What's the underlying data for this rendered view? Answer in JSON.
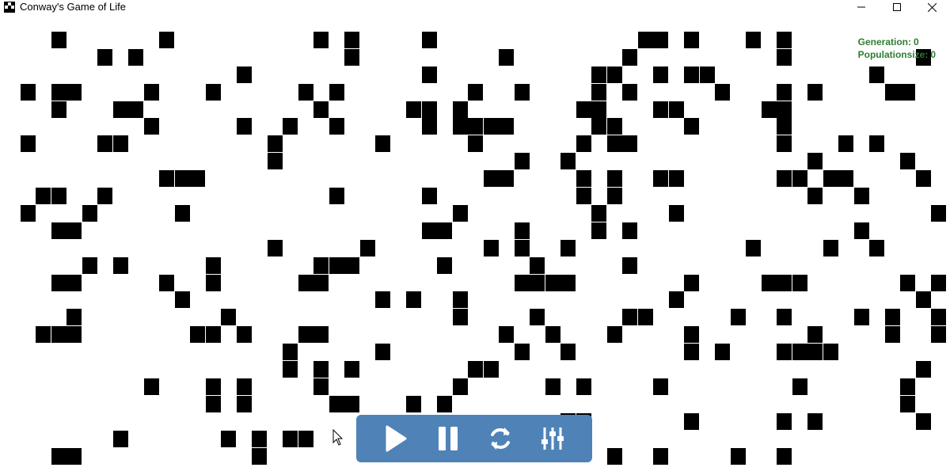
{
  "window": {
    "title": "Conway's Game of Life",
    "minimize_icon": "minimize-icon",
    "maximize_icon": "maximize-icon",
    "close_icon": "close-icon"
  },
  "stats": {
    "generation_label": "Generation:",
    "generation_value": "0",
    "population_label": "Populationsize:",
    "population_value": "0",
    "color": "#2e7d32"
  },
  "toolbar": {
    "background": "#4f83b8",
    "buttons": [
      {
        "icon": "play-icon"
      },
      {
        "icon": "pause-icon"
      },
      {
        "icon": "reset-icon"
      },
      {
        "icon": "settings-sliders-icon"
      }
    ]
  },
  "grid": {
    "columns": 61,
    "rows": 27,
    "live_cells": [
      [
        3,
        1
      ],
      [
        10,
        1
      ],
      [
        20,
        1
      ],
      [
        22,
        1
      ],
      [
        27,
        1
      ],
      [
        41,
        1
      ],
      [
        42,
        1
      ],
      [
        44,
        1
      ],
      [
        48,
        1
      ],
      [
        50,
        1
      ],
      [
        6,
        2
      ],
      [
        8,
        2
      ],
      [
        22,
        2
      ],
      [
        32,
        2
      ],
      [
        40,
        2
      ],
      [
        50,
        2
      ],
      [
        59,
        2
      ],
      [
        15,
        3
      ],
      [
        27,
        3
      ],
      [
        38,
        3
      ],
      [
        39,
        3
      ],
      [
        42,
        3
      ],
      [
        44,
        3
      ],
      [
        45,
        3
      ],
      [
        56,
        3
      ],
      [
        1,
        4
      ],
      [
        3,
        4
      ],
      [
        4,
        4
      ],
      [
        9,
        4
      ],
      [
        13,
        4
      ],
      [
        19,
        4
      ],
      [
        21,
        4
      ],
      [
        30,
        4
      ],
      [
        33,
        4
      ],
      [
        38,
        4
      ],
      [
        40,
        4
      ],
      [
        46,
        4
      ],
      [
        50,
        4
      ],
      [
        52,
        4
      ],
      [
        57,
        4
      ],
      [
        58,
        4
      ],
      [
        3,
        5
      ],
      [
        7,
        5
      ],
      [
        8,
        5
      ],
      [
        20,
        5
      ],
      [
        26,
        5
      ],
      [
        27,
        5
      ],
      [
        29,
        5
      ],
      [
        37,
        5
      ],
      [
        38,
        5
      ],
      [
        42,
        5
      ],
      [
        43,
        5
      ],
      [
        49,
        5
      ],
      [
        50,
        5
      ],
      [
        9,
        6
      ],
      [
        15,
        6
      ],
      [
        18,
        6
      ],
      [
        21,
        6
      ],
      [
        27,
        6
      ],
      [
        29,
        6
      ],
      [
        30,
        6
      ],
      [
        31,
        6
      ],
      [
        32,
        6
      ],
      [
        38,
        6
      ],
      [
        39,
        6
      ],
      [
        44,
        6
      ],
      [
        50,
        6
      ],
      [
        1,
        7
      ],
      [
        6,
        7
      ],
      [
        7,
        7
      ],
      [
        17,
        7
      ],
      [
        24,
        7
      ],
      [
        30,
        7
      ],
      [
        37,
        7
      ],
      [
        39,
        7
      ],
      [
        40,
        7
      ],
      [
        50,
        7
      ],
      [
        54,
        7
      ],
      [
        56,
        7
      ],
      [
        17,
        8
      ],
      [
        33,
        8
      ],
      [
        36,
        8
      ],
      [
        52,
        8
      ],
      [
        58,
        8
      ],
      [
        10,
        9
      ],
      [
        11,
        9
      ],
      [
        12,
        9
      ],
      [
        31,
        9
      ],
      [
        32,
        9
      ],
      [
        37,
        9
      ],
      [
        39,
        9
      ],
      [
        42,
        9
      ],
      [
        43,
        9
      ],
      [
        50,
        9
      ],
      [
        51,
        9
      ],
      [
        53,
        9
      ],
      [
        54,
        9
      ],
      [
        59,
        9
      ],
      [
        2,
        10
      ],
      [
        3,
        10
      ],
      [
        6,
        10
      ],
      [
        21,
        10
      ],
      [
        27,
        10
      ],
      [
        37,
        10
      ],
      [
        39,
        10
      ],
      [
        52,
        10
      ],
      [
        55,
        10
      ],
      [
        1,
        11
      ],
      [
        5,
        11
      ],
      [
        11,
        11
      ],
      [
        29,
        11
      ],
      [
        38,
        11
      ],
      [
        43,
        11
      ],
      [
        60,
        11
      ],
      [
        3,
        12
      ],
      [
        4,
        12
      ],
      [
        27,
        12
      ],
      [
        28,
        12
      ],
      [
        33,
        12
      ],
      [
        38,
        12
      ],
      [
        40,
        12
      ],
      [
        55,
        12
      ],
      [
        17,
        13
      ],
      [
        23,
        13
      ],
      [
        31,
        13
      ],
      [
        33,
        13
      ],
      [
        36,
        13
      ],
      [
        48,
        13
      ],
      [
        53,
        13
      ],
      [
        56,
        13
      ],
      [
        5,
        14
      ],
      [
        7,
        14
      ],
      [
        13,
        14
      ],
      [
        20,
        14
      ],
      [
        21,
        14
      ],
      [
        22,
        14
      ],
      [
        28,
        14
      ],
      [
        34,
        14
      ],
      [
        40,
        14
      ],
      [
        3,
        15
      ],
      [
        4,
        15
      ],
      [
        10,
        15
      ],
      [
        13,
        15
      ],
      [
        19,
        15
      ],
      [
        20,
        15
      ],
      [
        33,
        15
      ],
      [
        34,
        15
      ],
      [
        35,
        15
      ],
      [
        36,
        15
      ],
      [
        44,
        15
      ],
      [
        49,
        15
      ],
      [
        50,
        15
      ],
      [
        51,
        15
      ],
      [
        58,
        15
      ],
      [
        60,
        15
      ],
      [
        11,
        16
      ],
      [
        24,
        16
      ],
      [
        26,
        16
      ],
      [
        29,
        16
      ],
      [
        43,
        16
      ],
      [
        59,
        16
      ],
      [
        4,
        17
      ],
      [
        14,
        17
      ],
      [
        29,
        17
      ],
      [
        34,
        17
      ],
      [
        40,
        17
      ],
      [
        41,
        17
      ],
      [
        47,
        17
      ],
      [
        50,
        17
      ],
      [
        55,
        17
      ],
      [
        57,
        17
      ],
      [
        60,
        17
      ],
      [
        2,
        18
      ],
      [
        3,
        18
      ],
      [
        4,
        18
      ],
      [
        12,
        18
      ],
      [
        13,
        18
      ],
      [
        15,
        18
      ],
      [
        19,
        18
      ],
      [
        20,
        18
      ],
      [
        32,
        18
      ],
      [
        35,
        18
      ],
      [
        39,
        18
      ],
      [
        44,
        18
      ],
      [
        52,
        18
      ],
      [
        57,
        18
      ],
      [
        60,
        18
      ],
      [
        18,
        19
      ],
      [
        24,
        19
      ],
      [
        33,
        19
      ],
      [
        36,
        19
      ],
      [
        44,
        19
      ],
      [
        46,
        19
      ],
      [
        50,
        19
      ],
      [
        51,
        19
      ],
      [
        52,
        19
      ],
      [
        53,
        19
      ],
      [
        18,
        20
      ],
      [
        20,
        20
      ],
      [
        22,
        20
      ],
      [
        30,
        20
      ],
      [
        31,
        20
      ],
      [
        59,
        20
      ],
      [
        9,
        21
      ],
      [
        13,
        21
      ],
      [
        15,
        21
      ],
      [
        20,
        21
      ],
      [
        29,
        21
      ],
      [
        35,
        21
      ],
      [
        37,
        21
      ],
      [
        42,
        21
      ],
      [
        51,
        21
      ],
      [
        58,
        21
      ],
      [
        13,
        22
      ],
      [
        15,
        22
      ],
      [
        21,
        22
      ],
      [
        22,
        22
      ],
      [
        26,
        22
      ],
      [
        28,
        22
      ],
      [
        58,
        22
      ],
      [
        36,
        23
      ],
      [
        37,
        23
      ],
      [
        44,
        23
      ],
      [
        50,
        23
      ],
      [
        52,
        23
      ],
      [
        59,
        23
      ],
      [
        7,
        24
      ],
      [
        14,
        24
      ],
      [
        16,
        24
      ],
      [
        18,
        24
      ],
      [
        19,
        24
      ],
      [
        3,
        25
      ],
      [
        4,
        25
      ],
      [
        16,
        25
      ],
      [
        39,
        25
      ],
      [
        42,
        25
      ],
      [
        47,
        25
      ],
      [
        50,
        25
      ]
    ]
  }
}
